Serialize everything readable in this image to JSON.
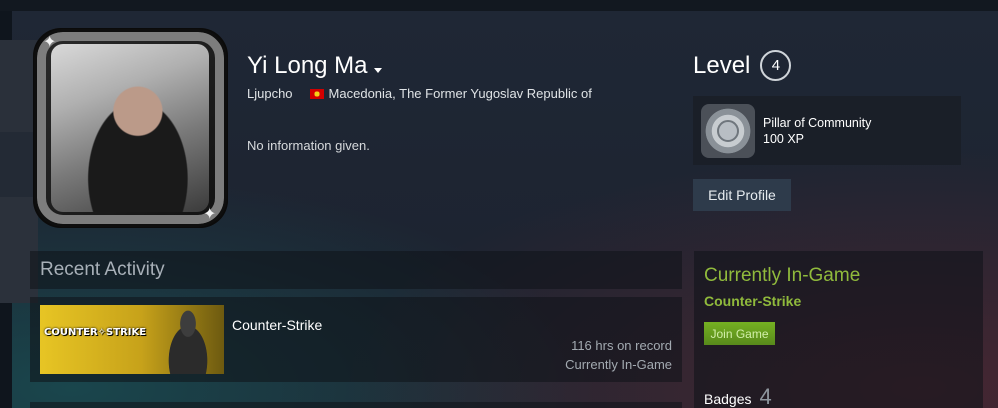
{
  "profile": {
    "persona_name": "Yi Long Ma",
    "real_name": "Ljupcho",
    "location": "Macedonia, The Former Yugoslav Republic of",
    "summary": "No information given."
  },
  "level": {
    "label": "Level",
    "value": "4"
  },
  "featured_badge": {
    "name": "Pillar of Community",
    "xp": "100 XP"
  },
  "actions": {
    "edit_profile": "Edit Profile"
  },
  "recent_activity": {
    "title": "Recent Activity",
    "games": [
      {
        "capsule_logo": "COUNTER✧STRIKE",
        "name": "Counter-Strike",
        "hours": "116 hrs on record",
        "status": "Currently In-Game"
      }
    ]
  },
  "status_panel": {
    "title": "Currently In-Game",
    "game": "Counter-Strike",
    "join_label": "Join Game",
    "badges_label": "Badges",
    "badges_count": "4"
  },
  "colors": {
    "ingame_green": "#90ba3c",
    "join_button": "#75b022",
    "background": "#1b2330"
  }
}
